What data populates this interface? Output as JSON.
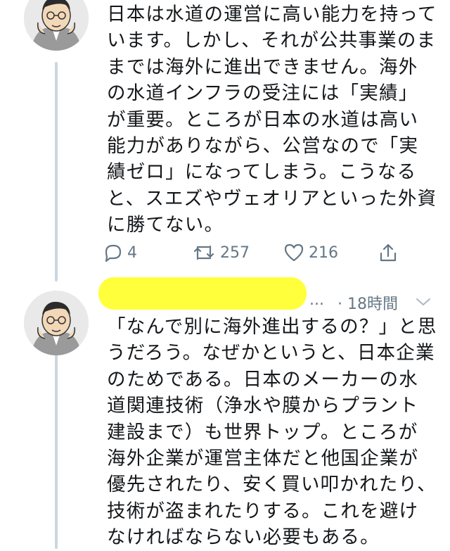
{
  "tweet1": {
    "text": "日本は水道の運営に高い能力を持っています。しかし、それが公共事業のままでは海外に進出できません。海外の水道インフラの受注には「実績」が重要。ところが日本の水道は高い能力がありながら、公営なので「実績ゼロ」になってしまう。こうなると、スエズやヴェオリアといった外資に勝てない。",
    "reply_count": "4",
    "retweet_count": "257",
    "like_count": "216",
    "icons": [
      "reply-icon",
      "retweet-icon",
      "like-icon",
      "share-icon"
    ]
  },
  "tweet2": {
    "meta_ellipsis": "...",
    "timestamp": "· 18時間",
    "text": "「なんで別に海外進出するの？」と思うだろう。なぜかというと、日本企業のためである。日本のメーカーの水道関連技術（浄水や膜からプラント建設まで）も世界トップ。ところが海外企業が運営主体だと他国企業が優先されたり、安く買い叩かれたり、技術が盗まれたりする。これを避けなければならない必要もある。",
    "icons": [
      "chevron-down-icon"
    ]
  },
  "colors": {
    "text": "#14171a",
    "secondary": "#657786",
    "thread_line": "#ccd6dd",
    "name_redaction": "#ffff3b"
  }
}
